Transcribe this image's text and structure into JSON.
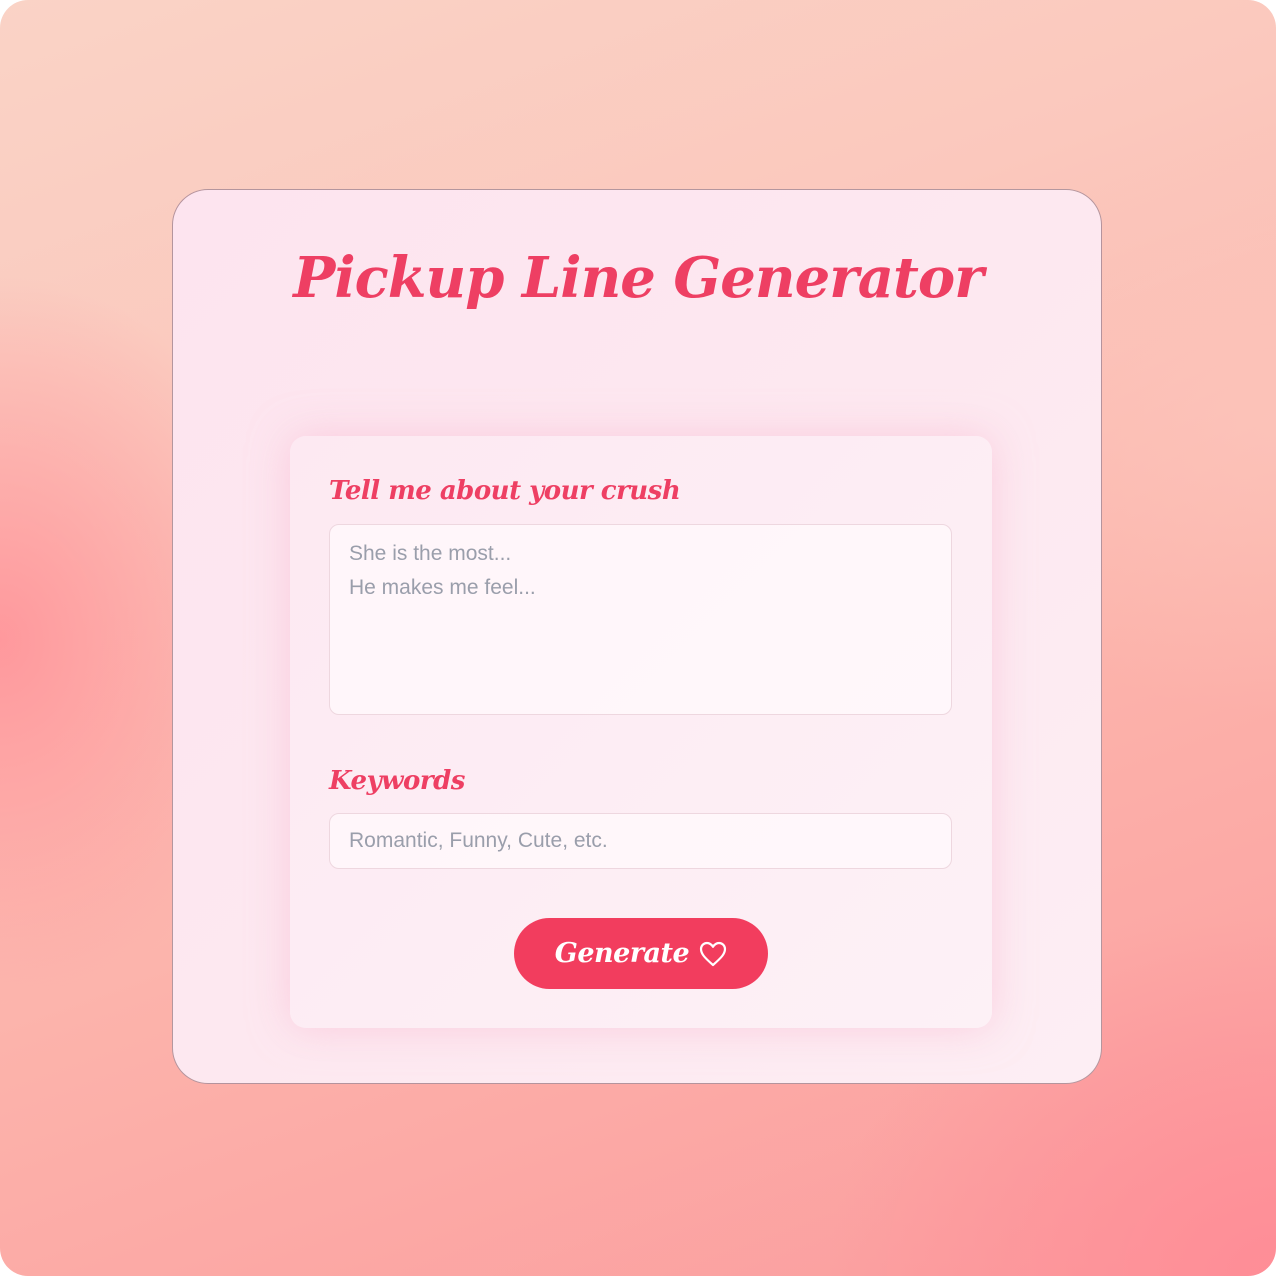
{
  "app": {
    "title": "Pickup Line Generator"
  },
  "form": {
    "crush_label": "Tell me about your crush",
    "crush_placeholder_lines": [
      "She is the most...",
      "He makes me feel..."
    ],
    "keywords_label": "Keywords",
    "keywords_placeholder": "Romantic, Funny, Cute, etc.",
    "generate_label": "Generate",
    "generate_icon": "heart-outline-icon"
  },
  "colors": {
    "accent": "#f23d5e",
    "title": "#ee3f63",
    "placeholder": "#9a9eab"
  }
}
